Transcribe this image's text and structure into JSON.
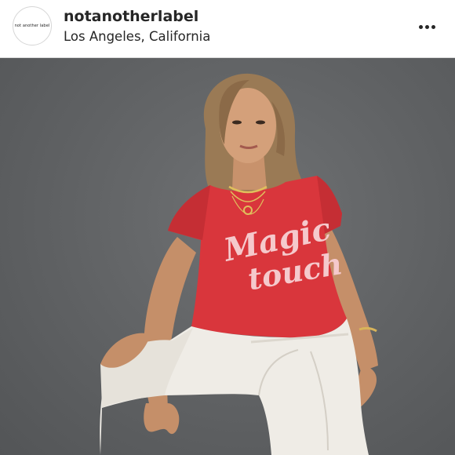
{
  "post": {
    "header": {
      "avatar_text": "not another label",
      "username": "notanotherlabel",
      "location": "Los Angeles, California",
      "more_icon": "more-horizontal-icon"
    },
    "photo": {
      "shirt_text_line1": "Magic",
      "shirt_text_line2": "touch"
    }
  },
  "colors": {
    "header_background": "#ffffff",
    "text": "#262626",
    "photo_background": "#5f6163",
    "shirt": "#d9363c",
    "shirt_print": "#f5c9cc",
    "pants": "#efece6"
  }
}
